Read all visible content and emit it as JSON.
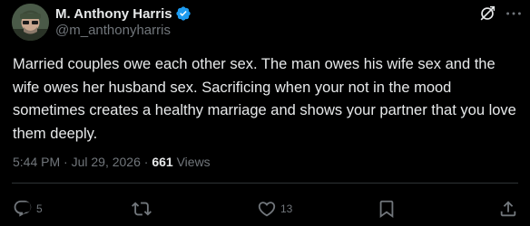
{
  "author": {
    "display_name": "M. Anthony Harris",
    "handle": "@m_anthonyharris",
    "verified": true
  },
  "post": {
    "text": "Married couples owe each other sex. The man owes his wife sex and the wife owes her husband sex. Sacrificing when your not in the mood sometimes creates a healthy marriage and shows your partner that you love them deeply."
  },
  "meta": {
    "time": "5:44 PM",
    "separator": " · ",
    "date": "Jul 29, 2026",
    "views_count": "661",
    "views_label": "Views"
  },
  "actions": {
    "replies": "5",
    "reposts": "",
    "likes": "13"
  },
  "colors": {
    "background": "#000000",
    "text_primary": "#e7e9ea",
    "text_secondary": "#71767b",
    "verified_blue": "#1d9bf0",
    "divider": "#2f3336"
  },
  "icons": {
    "avatar": "avatar-photo",
    "verified": "verified-badge-icon",
    "grok": "grok-icon",
    "more": "more-dots-icon",
    "reply": "reply-icon",
    "repost": "repost-icon",
    "like": "like-heart-icon",
    "bookmark": "bookmark-icon",
    "share": "share-icon"
  }
}
